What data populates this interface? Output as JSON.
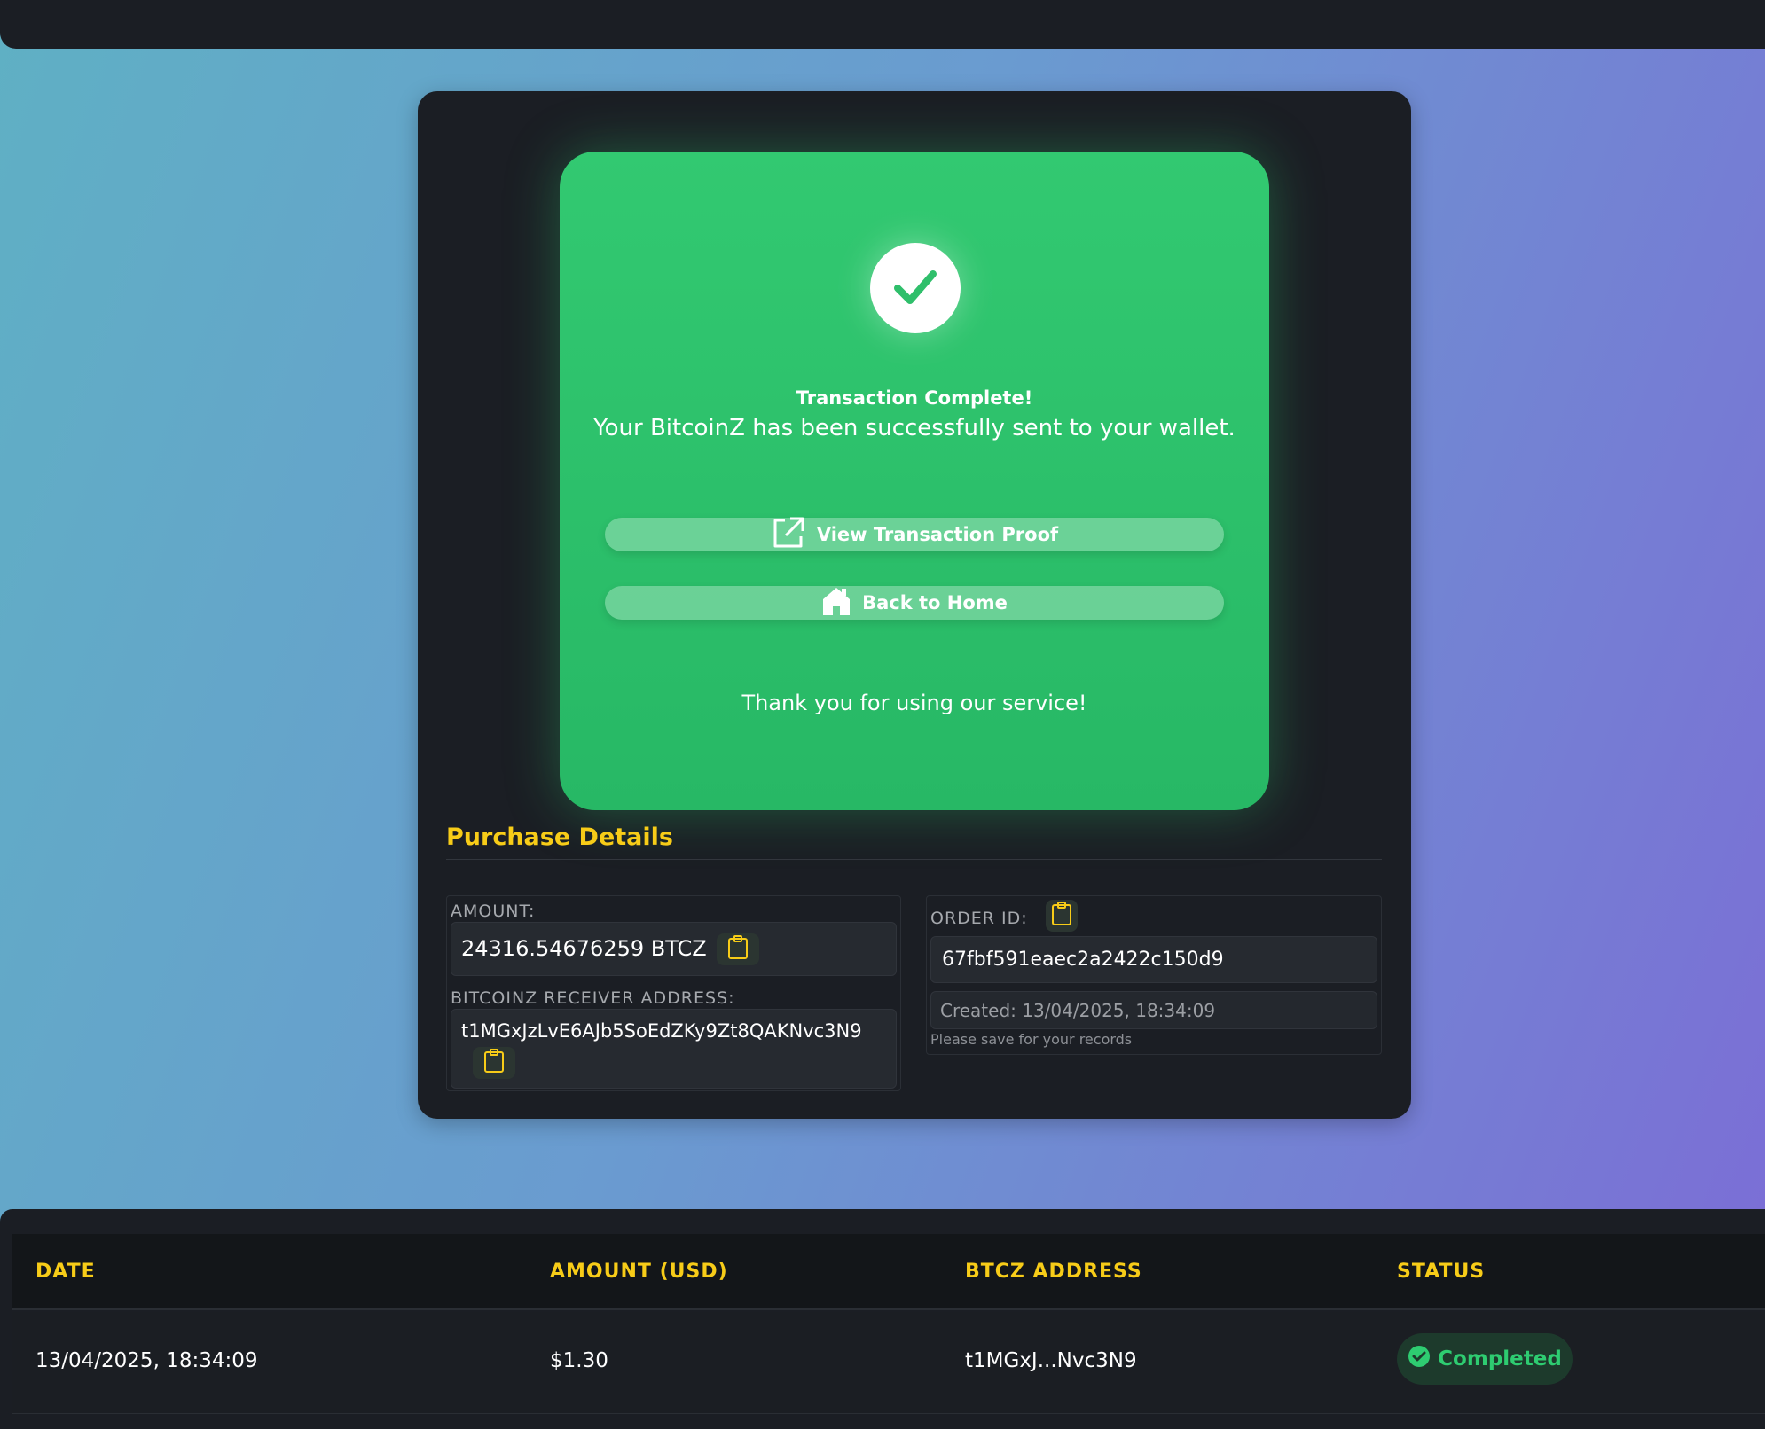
{
  "success": {
    "title": "Transaction Complete!",
    "message": "Your BitcoinZ has been successfully sent to your wallet.",
    "view_proof_label": "View Transaction Proof",
    "back_home_label": "Back to Home",
    "thanks": "Thank you for using our service!",
    "icons": {
      "check": "check-circle-icon",
      "proof": "external-link-icon",
      "home": "home-icon"
    }
  },
  "details": {
    "title": "Purchase Details",
    "amount_label": "AMOUNT:",
    "amount_value": "24316.54676259 BTCZ",
    "address_label": "BITCOINZ RECEIVER ADDRESS:",
    "address_value": "t1MGxJzLvE6AJb5SoEdZKy9Zt8QAKNvc3N9",
    "order_label": "ORDER ID:",
    "order_value": "67fbf591eaec2a2422c150d9",
    "created": "Created: 13/04/2025, 18:34:09",
    "note": "Please save for your records",
    "copy_icon": "clipboard-icon"
  },
  "table": {
    "headers": [
      "DATE",
      "AMOUNT (USD)",
      "BTCZ ADDRESS",
      "STATUS"
    ],
    "rows": [
      {
        "date": "13/04/2025, 18:34:09",
        "amount": "$1.30",
        "address": "t1MGxJ...Nvc3N9",
        "status": "Completed"
      }
    ]
  },
  "colors": {
    "accent_yellow": "#f7cc18",
    "success_green": "#2ecc71",
    "card_bg": "#1b1e24"
  }
}
